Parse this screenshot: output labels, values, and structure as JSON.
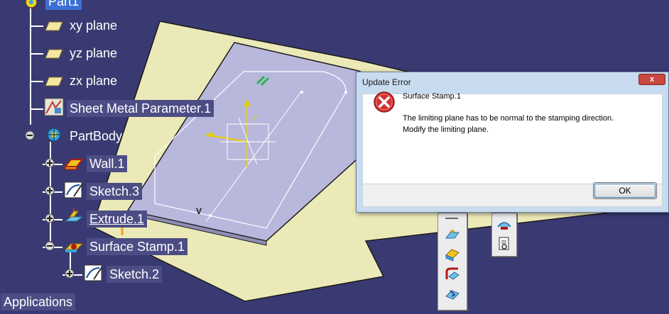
{
  "tree": {
    "root": "Part1",
    "items": [
      {
        "label": "xy plane"
      },
      {
        "label": "yz plane"
      },
      {
        "label": "zx plane"
      },
      {
        "label": "Sheet Metal Parameter.1"
      },
      {
        "label": "PartBody"
      },
      {
        "label": "Wall.1"
      },
      {
        "label": "Sketch.3"
      },
      {
        "label": "Extrude.1"
      },
      {
        "label": "Surface Stamp.1"
      },
      {
        "label": "Sketch.2"
      }
    ],
    "applications": "Applications"
  },
  "viewport": {
    "axis_label_v": "V"
  },
  "dialog": {
    "title": "Update Error",
    "close_label": "x",
    "message_title": "Surface Stamp.1",
    "message_line1": "The limiting plane has to be normal to the stamping direction.",
    "message_line2": "Modify the limiting plane.",
    "ok_label": "OK",
    "icon": "error-icon"
  },
  "toolbars": {
    "left_icons": [
      "stamp-tool-icon",
      "flange-tool-icon",
      "bend-tool-icon",
      "cut-tool-icon"
    ],
    "right_icons": [
      "stamp-surface-icon",
      "document-icon"
    ]
  },
  "colors": {
    "background": "#3a3a72",
    "plane_fill": "#ece9b8",
    "part_fill": "#b8b7dc",
    "tree_highlight": "#4d4d85",
    "error_red": "#d32f2f"
  }
}
